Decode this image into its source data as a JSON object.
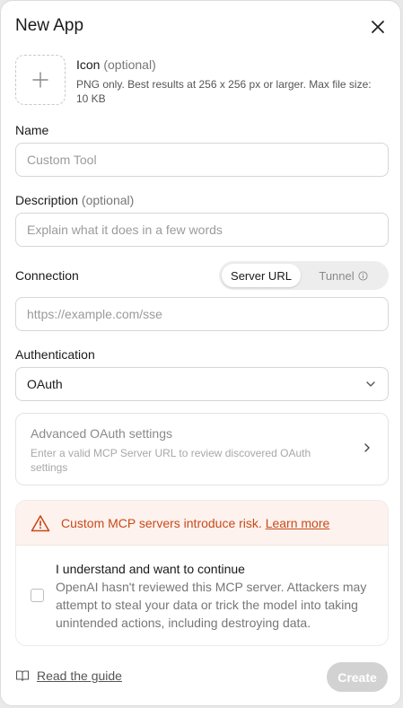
{
  "dialog": {
    "title": "New App"
  },
  "icon_section": {
    "label": "Icon",
    "optional": "(optional)",
    "description": "PNG only. Best results at 256 x 256 px or larger. Max file size: 10 KB"
  },
  "name": {
    "label": "Name",
    "placeholder": "Custom Tool",
    "value": ""
  },
  "description": {
    "label": "Description",
    "optional": "(optional)",
    "placeholder": "Explain what it does in a few words",
    "value": ""
  },
  "connection": {
    "label": "Connection",
    "options": [
      "Server URL",
      "Tunnel"
    ],
    "selected": "Server URL",
    "placeholder": "https://example.com/sse",
    "value": ""
  },
  "authentication": {
    "label": "Authentication",
    "selected": "OAuth"
  },
  "advanced": {
    "title": "Advanced OAuth settings",
    "description": "Enter a valid MCP Server URL to review discovered OAuth settings"
  },
  "warning": {
    "message": "Custom MCP servers introduce risk.",
    "link": "Learn more",
    "ack_title": "I understand and want to continue",
    "ack_description": "OpenAI hasn't reviewed this MCP server. Attackers may attempt to steal your data or trick the model into taking unintended actions, including destroying data.",
    "checked": false
  },
  "footer": {
    "guide_link": "Read the guide",
    "create_label": "Create"
  },
  "colors": {
    "warning_accent": "#c94a1a",
    "warning_bg": "#fdf2ee",
    "disabled_button": "#d2d2d2"
  }
}
